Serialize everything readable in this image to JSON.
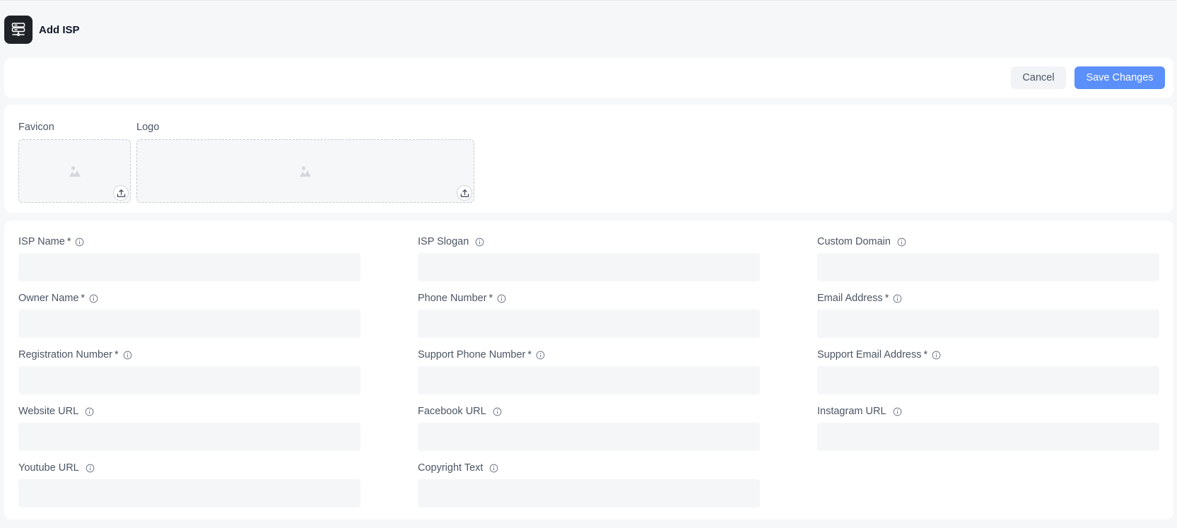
{
  "header": {
    "title": "Add ISP",
    "icon": "server-stack-icon"
  },
  "actions": {
    "cancel_label": "Cancel",
    "save_label": "Save Changes"
  },
  "media": {
    "favicon_label": "Favicon",
    "logo_label": "Logo"
  },
  "fields": [
    {
      "label": "ISP Name",
      "required": "*",
      "value": ""
    },
    {
      "label": "ISP Slogan",
      "required": "",
      "value": ""
    },
    {
      "label": "Custom Domain",
      "required": "",
      "value": ""
    },
    {
      "label": "Owner Name",
      "required": "*",
      "value": ""
    },
    {
      "label": "Phone Number",
      "required": "*",
      "value": ""
    },
    {
      "label": "Email Address",
      "required": "*",
      "value": ""
    },
    {
      "label": "Registration Number",
      "required": "*",
      "value": ""
    },
    {
      "label": "Support Phone Number",
      "required": "*",
      "value": ""
    },
    {
      "label": "Support Email Address",
      "required": "*",
      "value": ""
    },
    {
      "label": "Website URL",
      "required": "",
      "value": ""
    },
    {
      "label": "Facebook URL",
      "required": "",
      "value": ""
    },
    {
      "label": "Instagram URL",
      "required": "",
      "value": ""
    },
    {
      "label": "Youtube URL",
      "required": "",
      "value": ""
    },
    {
      "label": "Copyright Text",
      "required": "",
      "value": ""
    }
  ],
  "colors": {
    "primary": "#5b8ff9",
    "icon_bg": "#1f2328",
    "page_bg": "#f6f7f9"
  }
}
